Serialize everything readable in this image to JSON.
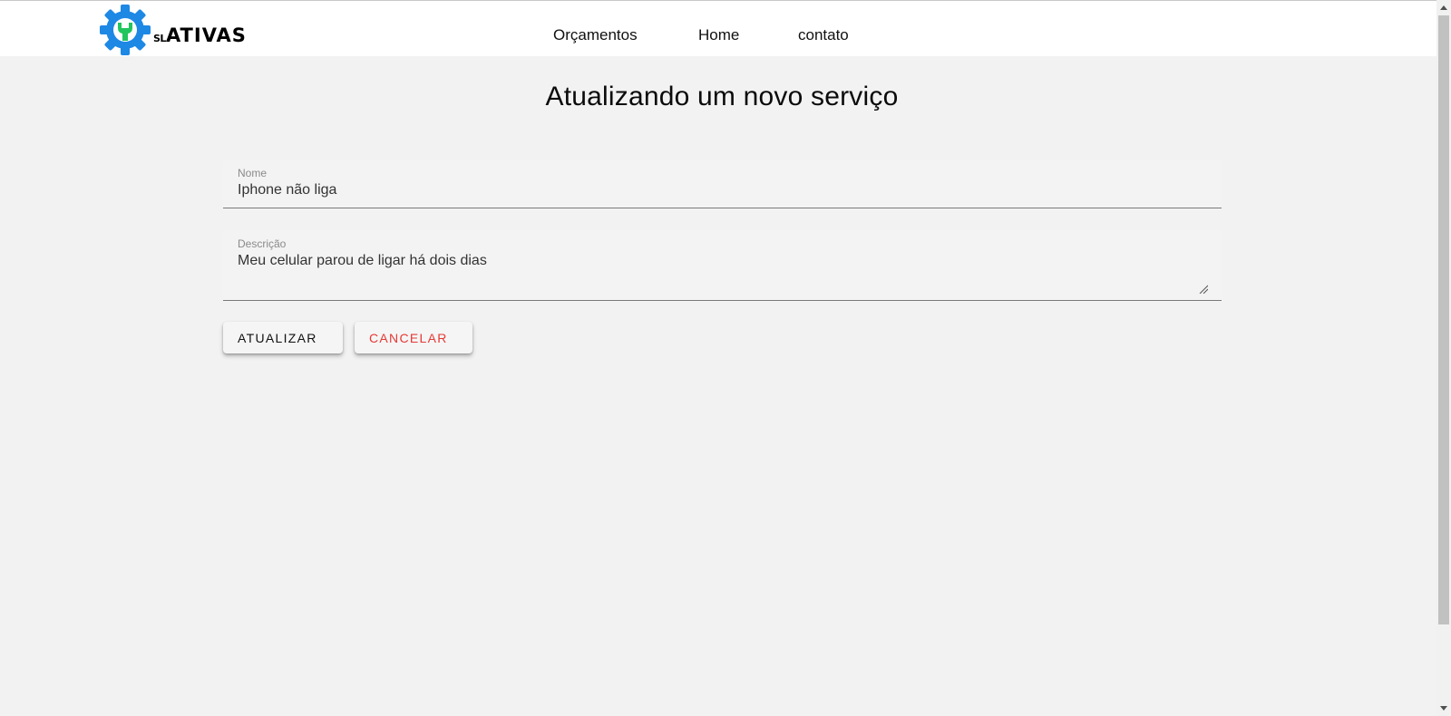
{
  "header": {
    "logo": {
      "small_text": "SL",
      "big_text": "ATIVAS",
      "icon": "gear-wrench-icon",
      "gear_color": "#1e88e5",
      "wrench_color": "#22c55e"
    },
    "nav": [
      {
        "label": "Orçamentos"
      },
      {
        "label": "Home"
      },
      {
        "label": "contato"
      }
    ]
  },
  "main": {
    "title": "Atualizando um novo serviço",
    "fields": {
      "nome": {
        "label": "Nome",
        "value": "Iphone não liga"
      },
      "descricao": {
        "label": "Descrição",
        "value": "Meu celular parou de ligar há dois dias"
      }
    },
    "buttons": {
      "atualizar": {
        "label": "ATUALIZAR",
        "color": "#111111"
      },
      "cancelar": {
        "label": "CANCELAR",
        "color": "#e53935"
      }
    }
  }
}
